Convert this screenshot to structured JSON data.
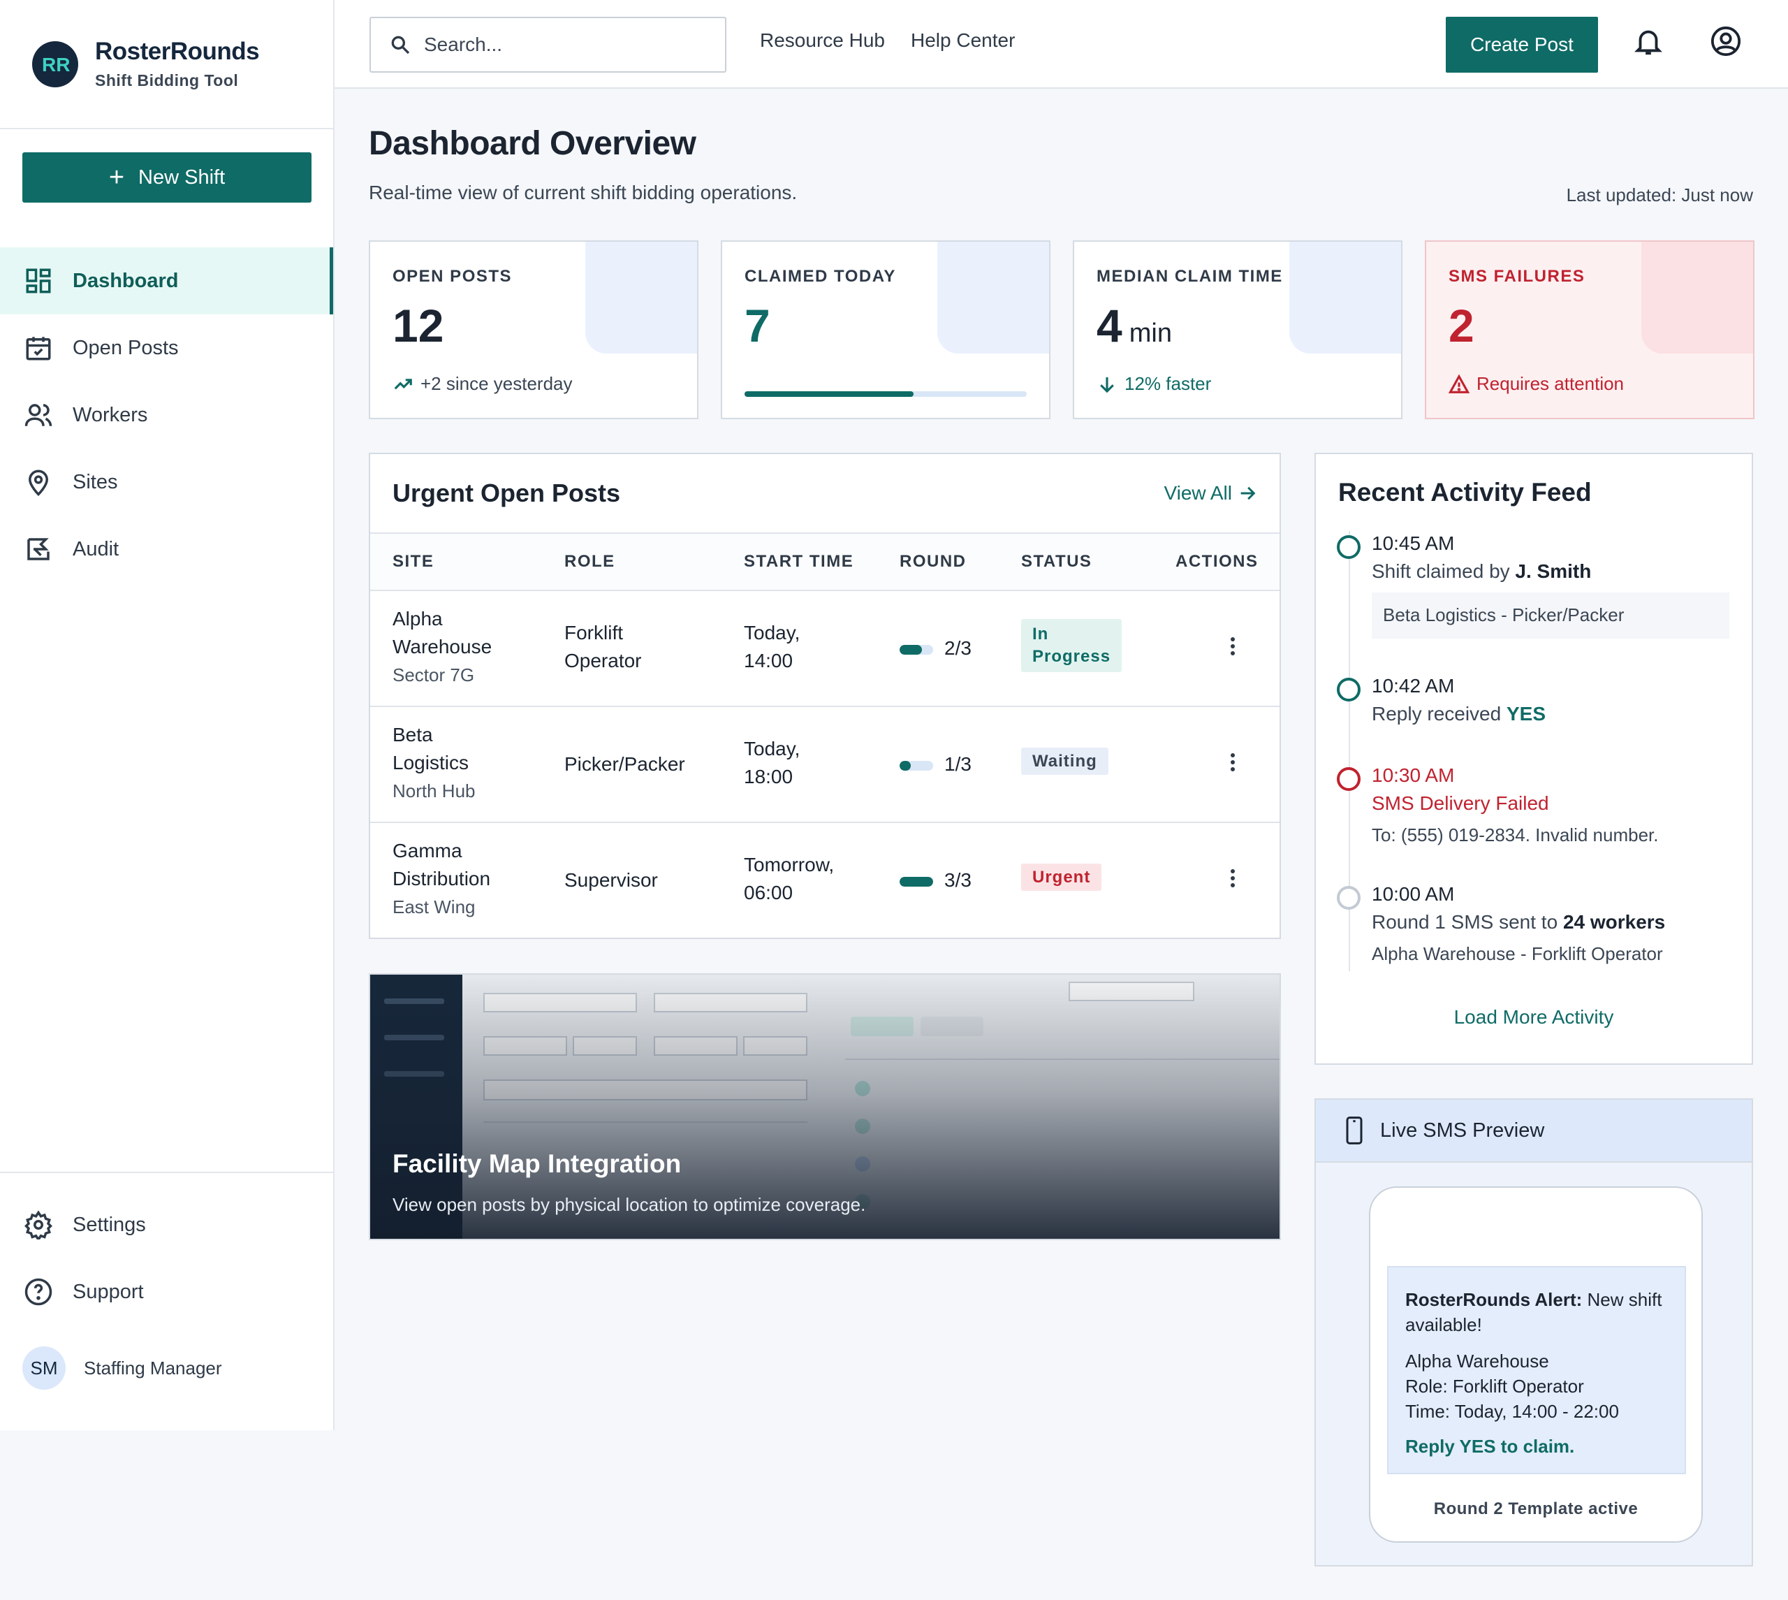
{
  "brand": {
    "name": "RosterRounds",
    "subtitle": "Shift Bidding Tool"
  },
  "sidebar": {
    "new_shift_label": "New Shift",
    "items": [
      {
        "label": "Dashboard",
        "icon": "dashboard-icon",
        "active": true
      },
      {
        "label": "Open Posts",
        "icon": "calendar-check-icon"
      },
      {
        "label": "Workers",
        "icon": "users-icon"
      },
      {
        "label": "Sites",
        "icon": "map-pin-icon"
      },
      {
        "label": "Audit",
        "icon": "audit-icon"
      }
    ],
    "bottom_items": [
      {
        "label": "Settings",
        "icon": "gear-icon"
      },
      {
        "label": "Support",
        "icon": "help-circle-icon"
      }
    ],
    "user": {
      "initials": "SM",
      "role": "Staffing Manager"
    }
  },
  "topbar": {
    "search_placeholder": "Search...",
    "links": [
      "Resource Hub",
      "Help Center"
    ],
    "create_post_label": "Create Post",
    "icons": [
      "bell-icon",
      "user-circle-icon"
    ]
  },
  "header": {
    "title": "Dashboard Overview",
    "subtitle": "Real-time view of current shift bidding operations.",
    "last_updated": "Last updated: Just now"
  },
  "stats": [
    {
      "label": "OPEN POSTS",
      "value": "12",
      "unit": "",
      "foot": "+2 since yesterday",
      "foot_icon": "trend-up-icon"
    },
    {
      "label": "CLAIMED TODAY",
      "value": "7",
      "unit": "",
      "progress": 0.6
    },
    {
      "label": "MEDIAN CLAIM TIME",
      "value": "4",
      "unit": "min",
      "foot": "12% faster",
      "foot_icon": "arrow-down-icon"
    },
    {
      "label": "SMS FAILURES",
      "value": "2",
      "unit": "",
      "foot": "Requires attention",
      "foot_icon": "warning-icon"
    }
  ],
  "urgent_posts": {
    "title": "Urgent Open Posts",
    "view_all": "View All",
    "columns": [
      "SITE",
      "ROLE",
      "START TIME",
      "ROUND",
      "STATUS",
      "ACTIONS"
    ],
    "rows": [
      {
        "site_line1": "Alpha",
        "site_line2": "Warehouse",
        "site_sub": "Sector 7G",
        "role_line1": "Forklift",
        "role_line2": "Operator",
        "start_line1": "Today,",
        "start_line2": "14:00",
        "round": "2/3",
        "round_fill": 0.67,
        "status_line1": "In",
        "status_line2": "Progress"
      },
      {
        "site_line1": "Beta",
        "site_line2": "Logistics",
        "site_sub": "North Hub",
        "role_line1": "Picker/Packer",
        "role_line2": "",
        "start_line1": "Today,",
        "start_line2": "18:00",
        "round": "1/3",
        "round_fill": 0.33,
        "status_line1": "Waiting",
        "status_line2": ""
      },
      {
        "site_line1": "Gamma",
        "site_line2": "Distribution",
        "site_sub": "East Wing",
        "role_line1": "Supervisor",
        "role_line2": "",
        "start_line1": "Tomorrow,",
        "start_line2": "06:00",
        "round": "3/3",
        "round_fill": 1.0,
        "status_line1": "Urgent",
        "status_line2": ""
      }
    ]
  },
  "facility_map": {
    "title": "Facility Map Integration",
    "subtitle": "View open posts by physical location to optimize coverage."
  },
  "activity_feed": {
    "title": "Recent Activity Feed",
    "items": [
      {
        "time": "10:45 AM",
        "text_prefix": "Shift claimed by ",
        "text_bold": "J. Smith",
        "note": "Beta Logistics - Picker/Packer"
      },
      {
        "time": "10:42 AM",
        "text_prefix": "Reply received ",
        "text_bold": "YES"
      },
      {
        "time": "10:30 AM",
        "text": "SMS Delivery Failed",
        "detail": "To: (555) 019-2834. Invalid number."
      },
      {
        "time": "10:00 AM",
        "text_prefix": "Round 1 SMS sent to ",
        "text_bold": "24 workers",
        "detail": "Alpha Warehouse - Forklift Operator"
      }
    ],
    "load_more": "Load More Activity"
  },
  "sms_preview": {
    "title": "Live SMS Preview",
    "message_bold": "RosterRounds Alert:",
    "message_rest": " New shift available!",
    "line_site": "Alpha Warehouse",
    "line_role": "Role: Forklift Operator",
    "line_time": "Time: Today, 14:00 - 22:00",
    "cta": "Reply YES to claim.",
    "footer": "Round 2 Template active"
  },
  "colors": {
    "accent": "#0f6b66",
    "danger": "#c0222f",
    "navy": "#15273d"
  }
}
